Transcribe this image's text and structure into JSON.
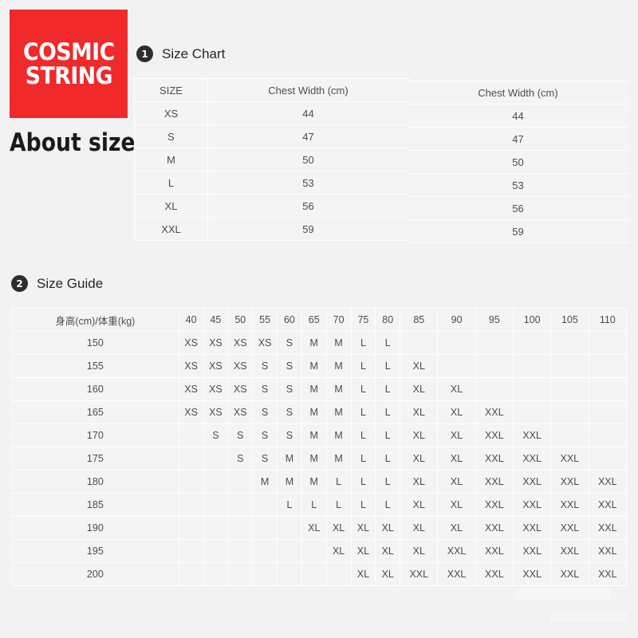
{
  "brand": {
    "logo_line_1": "COSMIC",
    "logo_line_2": "STRING",
    "logo_bg_color": "#f0292b",
    "tagline": "About size"
  },
  "sections": [
    {
      "number": "1",
      "title": "Size Chart"
    },
    {
      "number": "2",
      "title": "Size Guide"
    }
  ],
  "size_chart": {
    "headers": [
      "SIZE",
      "Chest Width (cm)",
      "Chest Width (cm)"
    ],
    "rows": [
      {
        "size": "XS",
        "chest_width": "44",
        "chest_width_2": "44"
      },
      {
        "size": "S",
        "chest_width": "47",
        "chest_width_2": "47"
      },
      {
        "size": "M",
        "chest_width": "50",
        "chest_width_2": "50"
      },
      {
        "size": "L",
        "chest_width": "53",
        "chest_width_2": "53"
      },
      {
        "size": "XL",
        "chest_width": "56",
        "chest_width_2": "56"
      },
      {
        "size": "XXL",
        "chest_width": "59",
        "chest_width_2": "59"
      }
    ]
  },
  "size_guide": {
    "corner_label": "身高(cm)/体重(kg)",
    "weights": [
      "40",
      "45",
      "50",
      "55",
      "60",
      "65",
      "70",
      "75",
      "80",
      "85",
      "90",
      "95",
      "100",
      "105",
      "110"
    ],
    "heights": [
      "150",
      "155",
      "160",
      "165",
      "170",
      "175",
      "180",
      "185",
      "190",
      "195",
      "200"
    ],
    "matrix": [
      [
        "XS",
        "XS",
        "XS",
        "XS",
        "S",
        "M",
        "M",
        "L",
        "L",
        "",
        "",
        "",
        "",
        "",
        ""
      ],
      [
        "XS",
        "XS",
        "XS",
        "S",
        "S",
        "M",
        "M",
        "L",
        "L",
        "XL",
        "",
        "",
        "",
        "",
        ""
      ],
      [
        "XS",
        "XS",
        "XS",
        "S",
        "S",
        "M",
        "M",
        "L",
        "L",
        "XL",
        "XL",
        "",
        "",
        "",
        ""
      ],
      [
        "XS",
        "XS",
        "XS",
        "S",
        "S",
        "M",
        "M",
        "L",
        "L",
        "XL",
        "XL",
        "XXL",
        "",
        "",
        ""
      ],
      [
        "",
        "S",
        "S",
        "S",
        "S",
        "M",
        "M",
        "L",
        "L",
        "XL",
        "XL",
        "XXL",
        "XXL",
        "",
        ""
      ],
      [
        "",
        "",
        "S",
        "S",
        "M",
        "M",
        "M",
        "L",
        "L",
        "XL",
        "XL",
        "XXL",
        "XXL",
        "XXL",
        ""
      ],
      [
        "",
        "",
        "",
        "M",
        "M",
        "M",
        "L",
        "L",
        "L",
        "XL",
        "XL",
        "XXL",
        "XXL",
        "XXL",
        "XXL"
      ],
      [
        "",
        "",
        "",
        "",
        "L",
        "L",
        "L",
        "L",
        "L",
        "XL",
        "XL",
        "XXL",
        "XXL",
        "XXL",
        "XXL"
      ],
      [
        "",
        "",
        "",
        "",
        "",
        "XL",
        "XL",
        "XL",
        "XL",
        "XL",
        "XL",
        "XXL",
        "XXL",
        "XXL",
        "XXL"
      ],
      [
        "",
        "",
        "",
        "",
        "",
        "",
        "XL",
        "XL",
        "XL",
        "XL",
        "XXL",
        "XXL",
        "XXL",
        "XXL",
        "XXL"
      ],
      [
        "",
        "",
        "",
        "",
        "",
        "",
        "",
        "XL",
        "XL",
        "XXL",
        "XXL",
        "XXL",
        "XXL",
        "XXL",
        "XXL"
      ]
    ]
  }
}
